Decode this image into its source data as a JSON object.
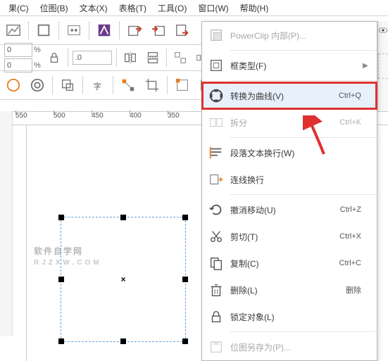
{
  "menubar": {
    "items": [
      "果(C)",
      "位图(B)",
      "文本(X)",
      "表格(T)",
      "工具(O)",
      "窗口(W)",
      "帮助(H)"
    ]
  },
  "toolbar2": {
    "val1": "0",
    "val2": "0",
    "decimal": ".0",
    "pct": "%"
  },
  "ruler": {
    "ticks": [
      "550",
      "500",
      "450",
      "400",
      "350"
    ]
  },
  "watermark": {
    "line1": "软件自学网",
    "line2": "RJZXW.COM"
  },
  "dropdown": {
    "items": [
      {
        "icon": "powerclip",
        "label": "PowerClip 内部(P)...",
        "shortcut": "",
        "arrow": false,
        "disabled": true
      },
      {
        "sep": true
      },
      {
        "icon": "frame",
        "label": "框类型(F)",
        "shortcut": "",
        "arrow": true,
        "disabled": false
      },
      {
        "sep": true
      },
      {
        "icon": "convert",
        "label": "转换为曲线(V)",
        "shortcut": "Ctrl+Q",
        "arrow": false,
        "disabled": false,
        "highlight": true
      },
      {
        "icon": "split",
        "label": "拆分",
        "shortcut": "Ctrl+K",
        "arrow": false,
        "disabled": true
      },
      {
        "sep": true
      },
      {
        "icon": "paratext",
        "label": "段落文本换行(W)",
        "shortcut": "",
        "arrow": false,
        "disabled": false
      },
      {
        "icon": "linewrap",
        "label": "连线换行",
        "shortcut": "",
        "arrow": false,
        "disabled": false
      },
      {
        "sep": true
      },
      {
        "icon": "undo",
        "label": "撤消移动(U)",
        "shortcut": "Ctrl+Z",
        "arrow": false,
        "disabled": false
      },
      {
        "icon": "cut",
        "label": "剪切(T)",
        "shortcut": "Ctrl+X",
        "arrow": false,
        "disabled": false
      },
      {
        "icon": "copy",
        "label": "复制(C)",
        "shortcut": "Ctrl+C",
        "arrow": false,
        "disabled": false
      },
      {
        "icon": "delete",
        "label": "删除(L)",
        "shortcut": "删除",
        "arrow": false,
        "disabled": false
      },
      {
        "icon": "lock",
        "label": "锁定对象(L)",
        "shortcut": "",
        "arrow": false,
        "disabled": false
      },
      {
        "sep": true
      },
      {
        "icon": "saveas",
        "label": "位图另存为(P)...",
        "shortcut": "",
        "arrow": false,
        "disabled": true
      }
    ]
  }
}
